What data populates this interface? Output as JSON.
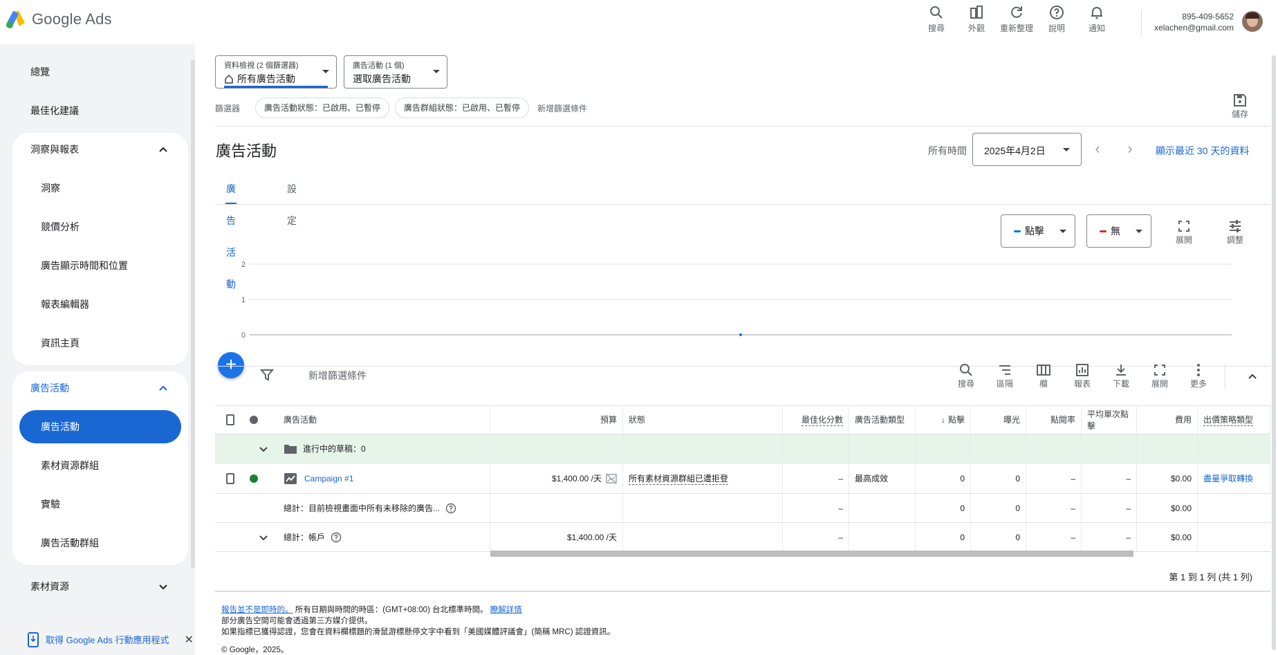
{
  "app": {
    "name": "Google Ads"
  },
  "topbar": {
    "icons": [
      {
        "label": "搜尋",
        "icon": "search-icon"
      },
      {
        "label": "外觀",
        "icon": "appearance-icon"
      },
      {
        "label": "重新整理",
        "icon": "refresh-icon"
      },
      {
        "label": "說明",
        "icon": "help-icon"
      },
      {
        "label": "通知",
        "icon": "bell-icon"
      }
    ],
    "account_id": "895-409-5652",
    "account_email": "xelachen@gmail.com"
  },
  "sidebar": {
    "overview": "總覽",
    "recommendations": "最佳化建議",
    "insights_section": "洞察與報表",
    "insights_items": [
      "洞察",
      "競價分析",
      "廣告顯示時間和位置",
      "報表編輯器",
      "資訊主頁"
    ],
    "campaigns_section": "廣告活動",
    "campaigns_items": [
      "廣告活動",
      "素材資源群組",
      "實驗",
      "廣告活動群組"
    ],
    "assets_section": "素材資源",
    "app_promo": "取得 Google Ads 行動應用程式"
  },
  "selectors": {
    "view_small": "資料檢視 (2 個篩選器)",
    "view_main": "所有廣告活動",
    "campaign_small": "廣告活動 (1 個)",
    "campaign_main": "選取廣告活動"
  },
  "filters": {
    "label": "篩選器",
    "chips": [
      "廣告活動狀態：已啟用、已暫停",
      "廣告群組狀態：已啟用、已暫停"
    ],
    "add": "新增篩選條件"
  },
  "save_label": "儲存",
  "page": {
    "title": "廣告活動",
    "date_label": "所有時間",
    "date_value": "2025年4月2日",
    "recent_link": "顯示最近 30 天的資料"
  },
  "tabs": [
    "廣告活動",
    "設定"
  ],
  "metrics": {
    "metric1": "點擊",
    "metric2": "無",
    "expand": "展開",
    "adjust": "調整",
    "metric1_color": "#1a73e8",
    "metric2_color": "#d93025"
  },
  "chart_data": {
    "type": "line",
    "y_ticks": [
      "2",
      "1",
      "0"
    ],
    "ylim": [
      0,
      2
    ],
    "series": [
      {
        "values": [
          0
        ]
      }
    ],
    "grid": true
  },
  "table_toolbar": {
    "filter_label": "新增篩選條件",
    "buttons": [
      {
        "label": "搜尋",
        "icon": "search-icon"
      },
      {
        "label": "區隔",
        "icon": "segment-icon"
      },
      {
        "label": "欄",
        "icon": "columns-icon"
      },
      {
        "label": "報表",
        "icon": "report-icon"
      },
      {
        "label": "下載",
        "icon": "download-icon"
      },
      {
        "label": "展開",
        "icon": "fullscreen-icon"
      },
      {
        "label": "更多",
        "icon": "more-vert-icon"
      }
    ]
  },
  "table": {
    "headers": {
      "campaign": "廣告活動",
      "budget": "預算",
      "status": "狀態",
      "opt_score": "最佳化分數",
      "type": "廣告活動類型",
      "clicks": "點擊",
      "impr": "曝光",
      "ctr": "點閱率",
      "avg_cpc": "平均單次點擊",
      "cost": "費用",
      "bidding": "出價策略類型"
    },
    "draft_row": "進行中的草稿：0",
    "campaign_row": {
      "name": "Campaign #1",
      "budget": "$1,400.00 /天",
      "status": "所有素材資源群組已遭拒登",
      "opt_score": "–",
      "type": "最高成效",
      "clicks": "0",
      "impr": "0",
      "ctr": "–",
      "avg_cpc": "–",
      "cost": "$0.00",
      "bidding": "盡量爭取轉換",
      "status_color": "#188038"
    },
    "total_view_row": {
      "label": "總計：目前檢視畫面中所有未移除的廣告...",
      "opt_score": "–",
      "clicks": "0",
      "impr": "0",
      "ctr": "–",
      "avg_cpc": "–",
      "cost": "$0.00"
    },
    "total_account_row": {
      "label": "總計：帳戶",
      "budget": "$1,400.00 /天",
      "opt_score": "–",
      "clicks": "0",
      "impr": "0",
      "ctr": "–",
      "avg_cpc": "–",
      "cost": "$0.00"
    }
  },
  "pager": "第 1 到 1 列 (共 1 列)",
  "footer": {
    "link1": "報告並不是即時的。",
    "text1": " 所有日期與時間的時區：(GMT+08:00) 台北標準時間。 ",
    "link2": "瞭解詳情",
    "line2": "部分廣告空間可能會透過第三方媒介提供。",
    "line3": "如果指標已獲得認證，您會在資料欄標題的滑鼠游標懸停文字中看到「美國媒體評議會」(簡稱 MRC) 認證資訊。",
    "copyright": "© Google，2025。"
  }
}
